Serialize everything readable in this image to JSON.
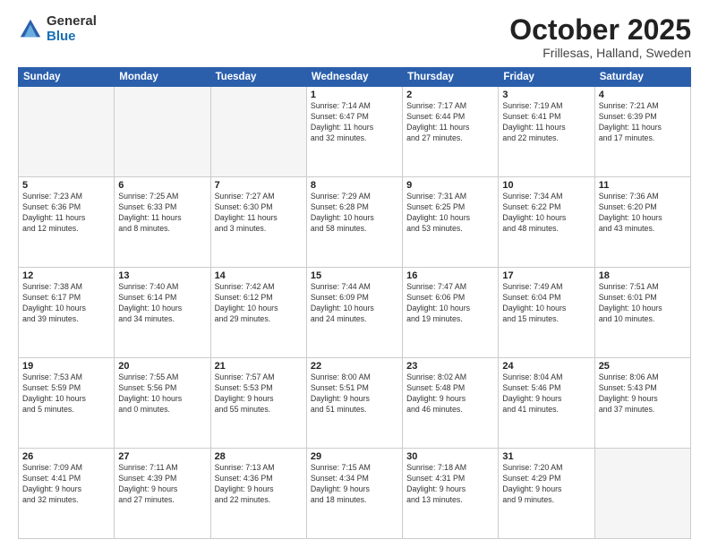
{
  "header": {
    "logo_general": "General",
    "logo_blue": "Blue",
    "month": "October 2025",
    "location": "Frillesas, Halland, Sweden"
  },
  "weekdays": [
    "Sunday",
    "Monday",
    "Tuesday",
    "Wednesday",
    "Thursday",
    "Friday",
    "Saturday"
  ],
  "weeks": [
    [
      {
        "day": "",
        "info": ""
      },
      {
        "day": "",
        "info": ""
      },
      {
        "day": "",
        "info": ""
      },
      {
        "day": "1",
        "info": "Sunrise: 7:14 AM\nSunset: 6:47 PM\nDaylight: 11 hours\nand 32 minutes."
      },
      {
        "day": "2",
        "info": "Sunrise: 7:17 AM\nSunset: 6:44 PM\nDaylight: 11 hours\nand 27 minutes."
      },
      {
        "day": "3",
        "info": "Sunrise: 7:19 AM\nSunset: 6:41 PM\nDaylight: 11 hours\nand 22 minutes."
      },
      {
        "day": "4",
        "info": "Sunrise: 7:21 AM\nSunset: 6:39 PM\nDaylight: 11 hours\nand 17 minutes."
      }
    ],
    [
      {
        "day": "5",
        "info": "Sunrise: 7:23 AM\nSunset: 6:36 PM\nDaylight: 11 hours\nand 12 minutes."
      },
      {
        "day": "6",
        "info": "Sunrise: 7:25 AM\nSunset: 6:33 PM\nDaylight: 11 hours\nand 8 minutes."
      },
      {
        "day": "7",
        "info": "Sunrise: 7:27 AM\nSunset: 6:30 PM\nDaylight: 11 hours\nand 3 minutes."
      },
      {
        "day": "8",
        "info": "Sunrise: 7:29 AM\nSunset: 6:28 PM\nDaylight: 10 hours\nand 58 minutes."
      },
      {
        "day": "9",
        "info": "Sunrise: 7:31 AM\nSunset: 6:25 PM\nDaylight: 10 hours\nand 53 minutes."
      },
      {
        "day": "10",
        "info": "Sunrise: 7:34 AM\nSunset: 6:22 PM\nDaylight: 10 hours\nand 48 minutes."
      },
      {
        "day": "11",
        "info": "Sunrise: 7:36 AM\nSunset: 6:20 PM\nDaylight: 10 hours\nand 43 minutes."
      }
    ],
    [
      {
        "day": "12",
        "info": "Sunrise: 7:38 AM\nSunset: 6:17 PM\nDaylight: 10 hours\nand 39 minutes."
      },
      {
        "day": "13",
        "info": "Sunrise: 7:40 AM\nSunset: 6:14 PM\nDaylight: 10 hours\nand 34 minutes."
      },
      {
        "day": "14",
        "info": "Sunrise: 7:42 AM\nSunset: 6:12 PM\nDaylight: 10 hours\nand 29 minutes."
      },
      {
        "day": "15",
        "info": "Sunrise: 7:44 AM\nSunset: 6:09 PM\nDaylight: 10 hours\nand 24 minutes."
      },
      {
        "day": "16",
        "info": "Sunrise: 7:47 AM\nSunset: 6:06 PM\nDaylight: 10 hours\nand 19 minutes."
      },
      {
        "day": "17",
        "info": "Sunrise: 7:49 AM\nSunset: 6:04 PM\nDaylight: 10 hours\nand 15 minutes."
      },
      {
        "day": "18",
        "info": "Sunrise: 7:51 AM\nSunset: 6:01 PM\nDaylight: 10 hours\nand 10 minutes."
      }
    ],
    [
      {
        "day": "19",
        "info": "Sunrise: 7:53 AM\nSunset: 5:59 PM\nDaylight: 10 hours\nand 5 minutes."
      },
      {
        "day": "20",
        "info": "Sunrise: 7:55 AM\nSunset: 5:56 PM\nDaylight: 10 hours\nand 0 minutes."
      },
      {
        "day": "21",
        "info": "Sunrise: 7:57 AM\nSunset: 5:53 PM\nDaylight: 9 hours\nand 55 minutes."
      },
      {
        "day": "22",
        "info": "Sunrise: 8:00 AM\nSunset: 5:51 PM\nDaylight: 9 hours\nand 51 minutes."
      },
      {
        "day": "23",
        "info": "Sunrise: 8:02 AM\nSunset: 5:48 PM\nDaylight: 9 hours\nand 46 minutes."
      },
      {
        "day": "24",
        "info": "Sunrise: 8:04 AM\nSunset: 5:46 PM\nDaylight: 9 hours\nand 41 minutes."
      },
      {
        "day": "25",
        "info": "Sunrise: 8:06 AM\nSunset: 5:43 PM\nDaylight: 9 hours\nand 37 minutes."
      }
    ],
    [
      {
        "day": "26",
        "info": "Sunrise: 7:09 AM\nSunset: 4:41 PM\nDaylight: 9 hours\nand 32 minutes."
      },
      {
        "day": "27",
        "info": "Sunrise: 7:11 AM\nSunset: 4:39 PM\nDaylight: 9 hours\nand 27 minutes."
      },
      {
        "day": "28",
        "info": "Sunrise: 7:13 AM\nSunset: 4:36 PM\nDaylight: 9 hours\nand 22 minutes."
      },
      {
        "day": "29",
        "info": "Sunrise: 7:15 AM\nSunset: 4:34 PM\nDaylight: 9 hours\nand 18 minutes."
      },
      {
        "day": "30",
        "info": "Sunrise: 7:18 AM\nSunset: 4:31 PM\nDaylight: 9 hours\nand 13 minutes."
      },
      {
        "day": "31",
        "info": "Sunrise: 7:20 AM\nSunset: 4:29 PM\nDaylight: 9 hours\nand 9 minutes."
      },
      {
        "day": "",
        "info": ""
      }
    ]
  ]
}
